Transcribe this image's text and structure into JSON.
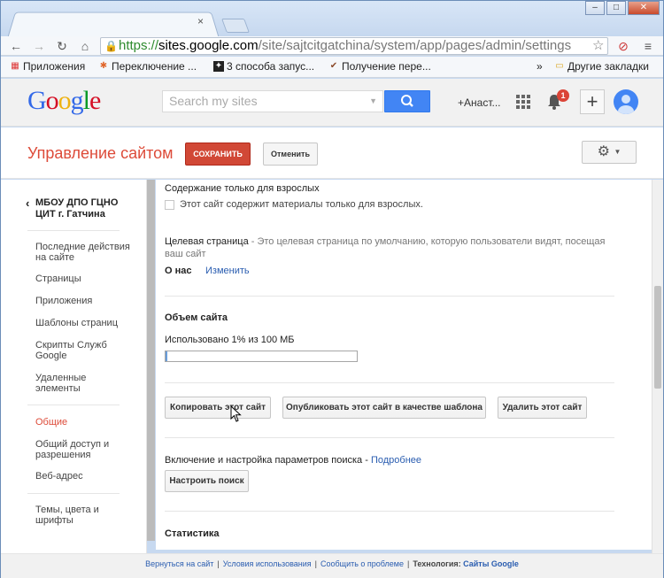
{
  "browser": {
    "tab_close": "×",
    "window_buttons": {
      "minimize": "–",
      "maximize": "□",
      "close": "✕"
    },
    "url": {
      "scheme": "https://",
      "host": "sites.google.com",
      "path": "/site/sajtcitgatchina/system/app/pages/admin/settings"
    },
    "bookmarks": [
      {
        "label": "Приложения",
        "icon": "apps-grid-icon"
      },
      {
        "label": "Переключение ...",
        "icon": "joomla-icon"
      },
      {
        "label": "3 способа запус...",
        "icon": "star-logo-icon"
      },
      {
        "label": "Получение пере...",
        "icon": "checkmark-icon"
      }
    ],
    "bookmarks_overflow": "»",
    "other_bookmarks": "Другие закладки"
  },
  "gbar": {
    "logo_letters": [
      {
        "ch": "G",
        "color": "#3369e8"
      },
      {
        "ch": "o",
        "color": "#d50f25"
      },
      {
        "ch": "o",
        "color": "#eeb211"
      },
      {
        "ch": "g",
        "color": "#3369e8"
      },
      {
        "ch": "l",
        "color": "#009925"
      },
      {
        "ch": "e",
        "color": "#d50f25"
      }
    ],
    "search_placeholder": "Search my sites",
    "user_name": "+Анаст...",
    "notification_count": "1",
    "plus_label": "+"
  },
  "header": {
    "title": "Управление сайтом",
    "save_label": "СОХРАНИТЬ",
    "cancel_label": "Отменить"
  },
  "sidebar": {
    "site_name": "МБОУ ДПО ГЦНО ЦИТ г. Гатчина",
    "items": [
      {
        "label": "Последние действия на сайте"
      },
      {
        "label": "Страницы"
      },
      {
        "label": "Приложения"
      },
      {
        "label": "Шаблоны страниц"
      },
      {
        "label": "Скрипты Служб Google"
      },
      {
        "label": "Удаленные элементы"
      },
      {
        "label": "Общие"
      },
      {
        "label": "Общий доступ и разрешения"
      },
      {
        "label": "Веб-адрес"
      },
      {
        "label": "Темы, цвета и шрифты"
      }
    ]
  },
  "main": {
    "adult": {
      "title": "Содержание только для взрослых",
      "checkbox_label": "Этот сайт содержит материалы только для взрослых."
    },
    "landing": {
      "title": "Целевая страница",
      "description": " - Это целевая страница по умолчанию, которую пользователи видят, посещая ваш сайт",
      "page": "О нас",
      "change_link": "Изменить"
    },
    "size": {
      "title": "Объем сайта",
      "usage_text": "Использовано 1% из 100 МБ",
      "usage_fraction": 0.01
    },
    "actions": {
      "copy": "Копировать этот сайт",
      "publish_template": "Опубликовать этот сайт в качестве шаблона",
      "delete": "Удалить этот сайт"
    },
    "search": {
      "text": "Включение и настройка параметров поиска - ",
      "more_link": "Подробнее",
      "button": "Настроить поиск"
    },
    "stats_title": "Статистика"
  },
  "footer": {
    "back": "Вернуться на сайт",
    "terms": "Условия использования",
    "report": "Сообщить о проблеме",
    "tech_label": "Технология:",
    "tech_link": "Сайты Google"
  }
}
